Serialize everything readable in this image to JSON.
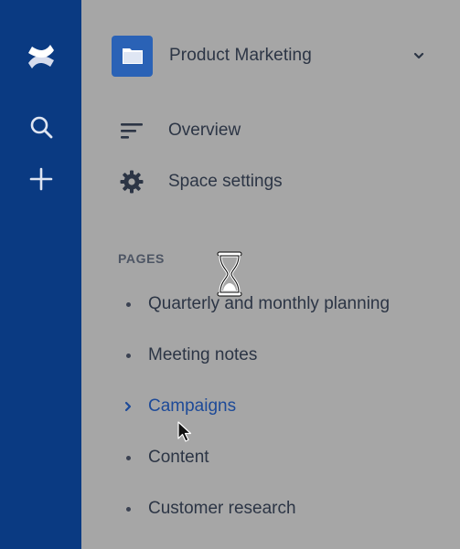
{
  "app": {
    "name": "Confluence",
    "colors": {
      "nav_bg": "#0a3a82",
      "sidebar_bg": "#a6a6a6",
      "text": "#2c3545",
      "active_link": "#1d4a98",
      "space_avatar": "#2a62b6"
    }
  },
  "global_nav": {
    "logo_icon": "confluence-logo-icon",
    "search_icon": "search-icon",
    "create_icon": "plus-icon"
  },
  "space": {
    "name": "Product Marketing",
    "avatar_icon": "folder-icon",
    "toggle_icon": "chevron-down-icon"
  },
  "menu": [
    {
      "label": "Overview",
      "icon": "overview-lines-icon"
    },
    {
      "label": "Space settings",
      "icon": "gear-icon"
    }
  ],
  "pages": {
    "heading": "PAGES",
    "items": [
      {
        "label": "Quarterly and monthly planning",
        "marker": "bullet",
        "active": false
      },
      {
        "label": "Meeting notes",
        "marker": "bullet",
        "active": false
      },
      {
        "label": "Campaigns",
        "marker": "chevron-right",
        "active": true
      },
      {
        "label": "Content",
        "marker": "bullet",
        "active": false
      },
      {
        "label": "Customer research",
        "marker": "bullet",
        "active": false
      }
    ]
  },
  "overlay": {
    "busy_icon": "hourglass-icon",
    "pointer_icon": "mouse-pointer-icon"
  }
}
